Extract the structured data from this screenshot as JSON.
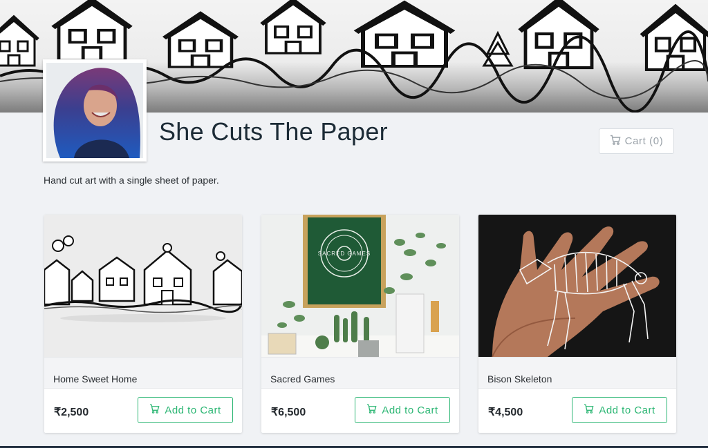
{
  "shop": {
    "title": "She Cuts The Paper",
    "tagline": "Hand cut art with a single sheet of paper."
  },
  "cart": {
    "label": "Cart (0)",
    "icon": "cart-icon"
  },
  "products": [
    {
      "name": "Home Sweet Home",
      "price": "₹2,500",
      "button": "Add to Cart",
      "image": "paper-cut-houses"
    },
    {
      "name": "Sacred Games",
      "price": "₹6,500",
      "button": "Add to Cart",
      "image": "framed-print-with-plants",
      "image_text": "SACRED GAMES"
    },
    {
      "name": "Bison Skeleton",
      "price": "₹4,500",
      "button": "Add to Cart",
      "image": "paper-cut-bison-skeleton-on-hand"
    }
  ],
  "colors": {
    "accent": "#2bb673",
    "title": "#1c2b36",
    "page_bg": "#f0f2f5"
  }
}
